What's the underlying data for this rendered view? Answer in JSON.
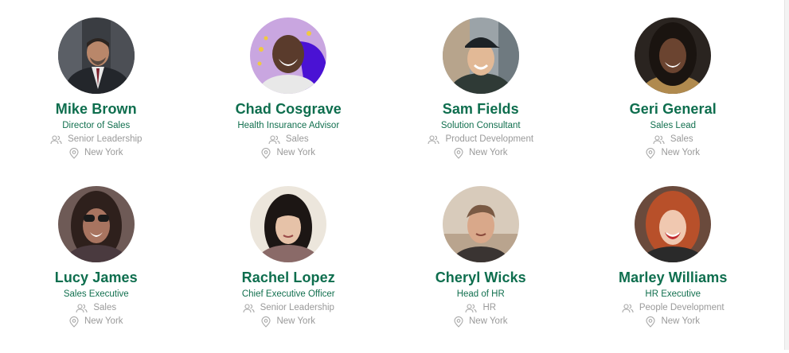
{
  "people": [
    {
      "name": "Mike Brown",
      "title": "Director of Sales",
      "department": "Senior Leadership",
      "location": "New York"
    },
    {
      "name": "Chad Cosgrave",
      "title": "Health Insurance Advisor",
      "department": "Sales",
      "location": "New York"
    },
    {
      "name": "Sam Fields",
      "title": "Solution Consultant",
      "department": "Product Development",
      "location": "New York"
    },
    {
      "name": "Geri General",
      "title": "Sales Lead",
      "department": "Sales",
      "location": "New York"
    },
    {
      "name": "Lucy James",
      "title": "Sales Executive",
      "department": "Sales",
      "location": "New York"
    },
    {
      "name": "Rachel Lopez",
      "title": "Chief Executive Officer",
      "department": "Senior Leadership",
      "location": "New York"
    },
    {
      "name": "Cheryl Wicks",
      "title": "Head of HR",
      "department": "HR",
      "location": "New York"
    },
    {
      "name": "Marley Williams",
      "title": "HR Executive",
      "department": "People Development",
      "location": "New York"
    }
  ],
  "icons": {
    "department": "people-icon",
    "location": "map-pin-icon"
  },
  "colors": {
    "name": "#0e6e4e",
    "title": "#12704f",
    "meta": "#9a9a9a"
  }
}
